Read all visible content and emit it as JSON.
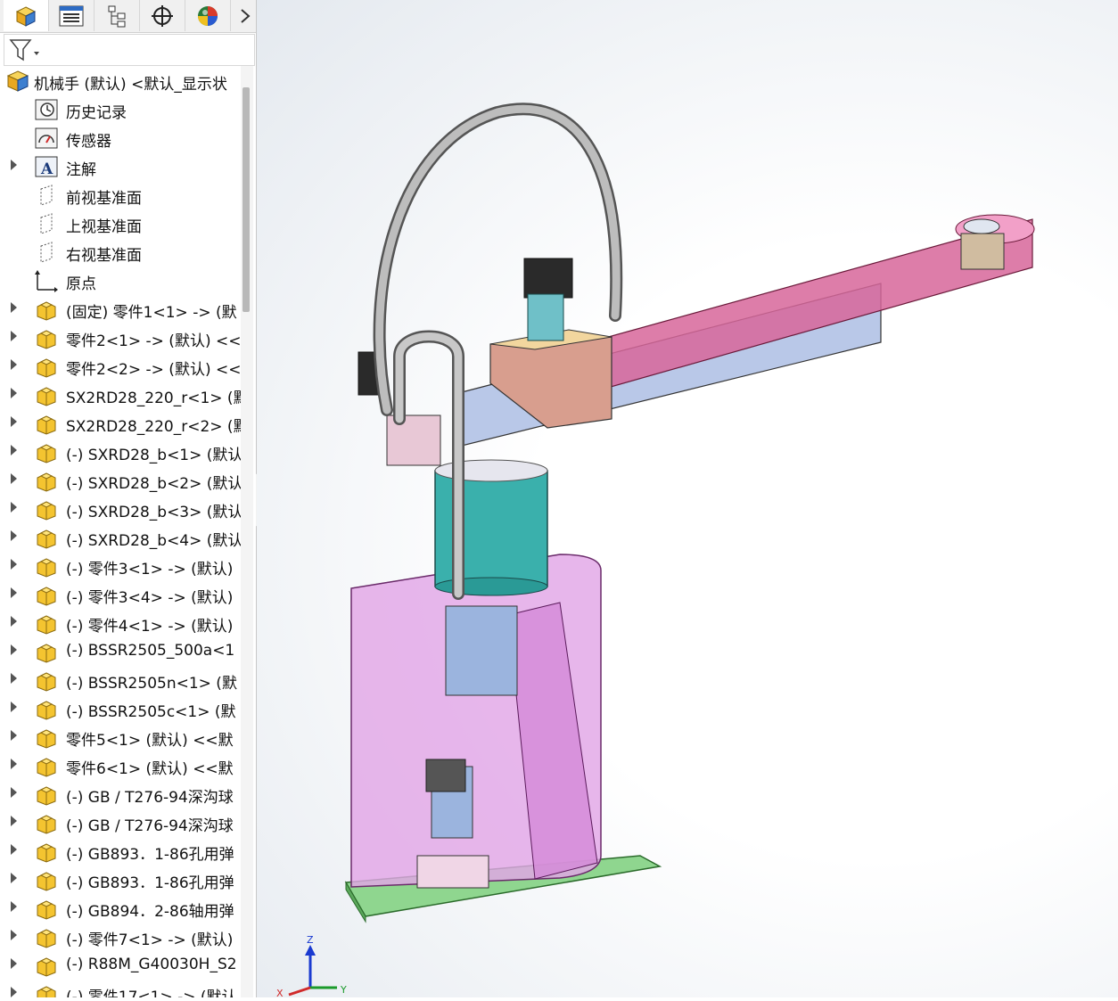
{
  "tabs": [
    {
      "name": "feature-manager-tab",
      "icon": "part-cube-icon"
    },
    {
      "name": "property-manager-tab",
      "icon": "property-list-icon"
    },
    {
      "name": "configuration-manager-tab",
      "icon": "configuration-tree-icon"
    },
    {
      "name": "dimxpert-tab",
      "icon": "crosshair-target-icon"
    },
    {
      "name": "display-manager-tab",
      "icon": "color-sphere-icon"
    }
  ],
  "tree": {
    "root_label": "机械手 (默认) <默认_显示状",
    "items": [
      {
        "label": "历史记录",
        "icon": "history-icon",
        "expandable": false
      },
      {
        "label": "传感器",
        "icon": "sensor-icon",
        "expandable": false
      },
      {
        "label": "注解",
        "icon": "annotation-icon",
        "expandable": true
      },
      {
        "label": "前视基准面",
        "icon": "plane-icon",
        "expandable": false
      },
      {
        "label": "上视基准面",
        "icon": "plane-icon",
        "expandable": false
      },
      {
        "label": "右视基准面",
        "icon": "plane-icon",
        "expandable": false
      },
      {
        "label": "原点",
        "icon": "origin-icon",
        "expandable": false
      },
      {
        "label": "(固定) 零件1<1> -> (默",
        "icon": "part-icon",
        "expandable": true
      },
      {
        "label": "零件2<1> -> (默认) <<",
        "icon": "part-icon",
        "expandable": true
      },
      {
        "label": "零件2<2> -> (默认) <<",
        "icon": "part-icon",
        "expandable": true
      },
      {
        "label": "SX2RD28_220_r<1> (默",
        "icon": "part-icon",
        "expandable": true
      },
      {
        "label": "SX2RD28_220_r<2> (默",
        "icon": "part-icon",
        "expandable": true
      },
      {
        "label": "(-) SXRD28_b<1> (默认",
        "icon": "part-icon",
        "expandable": true
      },
      {
        "label": "(-) SXRD28_b<2> (默认",
        "icon": "part-icon",
        "expandable": true
      },
      {
        "label": "(-) SXRD28_b<3> (默认",
        "icon": "part-icon",
        "expandable": true
      },
      {
        "label": "(-) SXRD28_b<4> (默认",
        "icon": "part-icon",
        "expandable": true
      },
      {
        "label": "(-) 零件3<1> -> (默认)",
        "icon": "part-icon",
        "expandable": true
      },
      {
        "label": "(-) 零件3<4> -> (默认)",
        "icon": "part-icon",
        "expandable": true
      },
      {
        "label": "(-) 零件4<1> -> (默认)",
        "icon": "part-icon",
        "expandable": true
      },
      {
        "label": "(-) BSSR2505_500a<1",
        "icon": "part-icon",
        "expandable": true
      },
      {
        "label": "(-) BSSR2505n<1> (默",
        "icon": "part-icon",
        "expandable": true
      },
      {
        "label": "(-) BSSR2505c<1> (默",
        "icon": "part-icon",
        "expandable": true
      },
      {
        "label": "零件5<1> (默认) <<默",
        "icon": "part-icon",
        "expandable": true
      },
      {
        "label": "零件6<1> (默认) <<默",
        "icon": "part-icon",
        "expandable": true
      },
      {
        "label": "(-) GB / T276-94深沟球",
        "icon": "part-icon",
        "expandable": true
      },
      {
        "label": "(-) GB / T276-94深沟球",
        "icon": "part-icon",
        "expandable": true
      },
      {
        "label": "(-) GB893．1-86孔用弹",
        "icon": "part-icon",
        "expandable": true
      },
      {
        "label": "(-) GB893．1-86孔用弹",
        "icon": "part-icon",
        "expandable": true
      },
      {
        "label": "(-) GB894．2-86轴用弹",
        "icon": "part-icon",
        "expandable": true
      },
      {
        "label": "(-) 零件7<1> -> (默认)",
        "icon": "part-icon",
        "expandable": true
      },
      {
        "label": "(-) R88M_G40030H_S2",
        "icon": "part-icon",
        "expandable": true
      },
      {
        "label": "(-) 零件17<1> -> (默认",
        "icon": "part-icon",
        "expandable": true
      }
    ]
  },
  "triad": {
    "z": "Z",
    "y": "Y",
    "x": "X"
  },
  "colors": {
    "accent": "#f0c020",
    "magenta": "#d87ab0",
    "teal": "#4fb8b8",
    "green": "#88d088"
  }
}
